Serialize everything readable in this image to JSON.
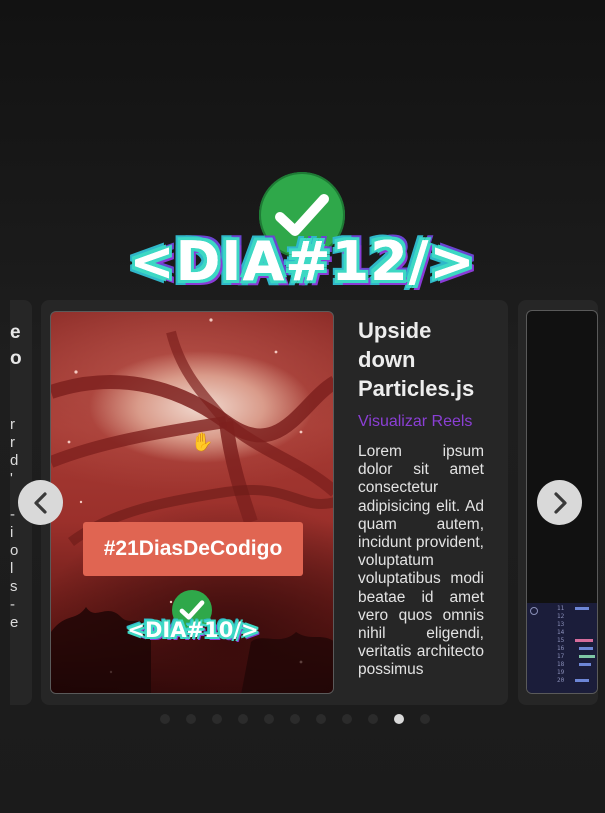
{
  "header": {
    "check_icon": "check-circle-icon",
    "title": "<DIA#12/>"
  },
  "carousel": {
    "prev_card": {
      "fragments": [
        "e",
        "o"
      ],
      "lines": [
        "r",
        "r",
        "d",
        "'",
        "-",
        "i",
        "o",
        "l",
        "s",
        "-",
        "e"
      ]
    },
    "main_card": {
      "thumbnail": {
        "hashtag": "#21DiasDeCodigo",
        "badge_title": "<DIA#10/>",
        "check_icon": "check-circle-icon",
        "cursor_icon": "hand-cursor-icon"
      },
      "title": "Upside down Particles.js",
      "link": "Visualizar Reels",
      "description": "Lorem ipsum dolor sit amet consectetur adipisicing elit. Ad quam autem, incidunt provident, voluptatum voluptatibus modi beatae id amet vero quos omnis nihil eligendi, veritatis architecto possimus"
    },
    "next_card": {
      "code_lines": [
        "11",
        "12",
        "13",
        "14",
        "15",
        "16",
        "17",
        "18",
        "19",
        "20"
      ]
    },
    "prev_button_icon": "chevron-left-icon",
    "next_button_icon": "chevron-right-icon",
    "dots_count": 11,
    "active_dot_index": 9
  },
  "colors": {
    "background": "#161616",
    "card": "#262626",
    "link": "#8a3fd4",
    "check": "#2fa84a",
    "hashtag_bg": "#e06552"
  }
}
